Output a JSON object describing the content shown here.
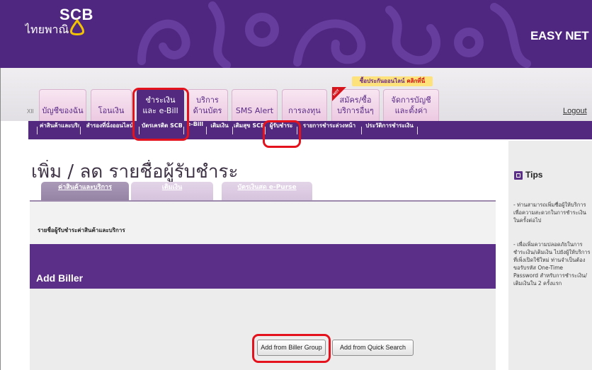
{
  "colors": {
    "brand_purple": "#4f2780",
    "subnav_purple": "#52297f",
    "accent_gold": "#f4c300",
    "tab_pink": "#f0d3e8",
    "highlight_red": "#e4121c"
  },
  "header": {
    "logo_text": "SCB",
    "logo_thai": "ไทยพาณิชย์",
    "logo_icon": "scb-lotus-icon",
    "product_name": "EASY NET"
  },
  "promo": {
    "text": "ซื้อประกันออนไลน์",
    "link": "คลิกที่นี่"
  },
  "nav": {
    "marker": "XII",
    "tabs": [
      {
        "lines": [
          "บัญชีของฉัน"
        ],
        "active": false
      },
      {
        "lines": [
          "โอนเงิน"
        ],
        "active": false
      },
      {
        "lines": [
          "ชำระเงิน",
          "และ e-Bill"
        ],
        "active": true
      },
      {
        "lines": [
          "บริการ",
          "ด้านบัตร"
        ],
        "active": false
      },
      {
        "lines": [
          "SMS Alert"
        ],
        "active": false
      },
      {
        "lines": [
          "การลงทุน"
        ],
        "active": false
      },
      {
        "lines": [
          "สมัคร/ซื้อ",
          "บริการอื่นๆ"
        ],
        "active": false,
        "badge": "HOT"
      },
      {
        "lines": [
          "จัดการบัญชี",
          "และตั้งค่า"
        ],
        "active": false
      }
    ],
    "logout": "Logout"
  },
  "subnav": {
    "items": [
      "ค่าสินค้าและบริการ",
      "สำรองที่นั่งออนไลน์",
      "บัตรเครดิต SCB",
      "e-Bill",
      "เติมเงิน",
      "เติมสุข SCB",
      "ผู้รับชำระ",
      "รายการชำระล่วงหน้า",
      "ประวัติการชำระเงิน"
    ]
  },
  "page": {
    "title": "เพิ่ม / ลด รายชื่อผู้รับชำระ"
  },
  "biller_tabs": [
    {
      "label": "ค่าสินค้าและบริการ",
      "active": true
    },
    {
      "label": "เติมเงิน",
      "active": false
    },
    {
      "label": "บัตรเงินสด e-Purse",
      "active": false
    }
  ],
  "biller_list": {
    "heading": "รายชื่อผู้รับชำระค่าสินค้าและบริการ"
  },
  "add_biller": {
    "title": "Add Biller",
    "group_button": "Add from Biller Group",
    "quick_search_button": "Add from Quick Search"
  },
  "tips": {
    "title": "Tips",
    "icon": "tips-icon",
    "items": [
      {
        "lines": [
          "- ท่านสามารถเพิ่มชื่อผู้ให้บริการ",
          "เพื่อความสะดวกในการชำระเงิน",
          "ในครั้งต่อไป"
        ]
      },
      {
        "lines": [
          "- เพื่อเพิ่มความปลอดภัยในการ",
          "ชำระเงิน/เติมเงิน ไปยังผู้ให้บริการ",
          "ที่เพิ่งเปิดใช้ใหม่ ท่านจำเป็นต้อง",
          "ขอรับรหัส One-Time",
          "Password สำหรับการชำระเงิน/",
          "เติมเงินใน 2 ครั้งแรก"
        ]
      }
    ]
  }
}
